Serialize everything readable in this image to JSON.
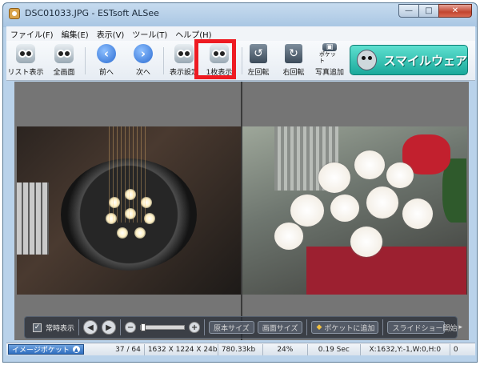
{
  "window": {
    "title": "DSC01033.JPG - ESTsoft ALSee",
    "minimize_label": "—",
    "maximize_label": "□",
    "close_label": "✕"
  },
  "menu": {
    "items": [
      "ファイル(F)",
      "編集(E)",
      "表示(V)",
      "ツール(T)",
      "ヘルプ(H)"
    ]
  },
  "toolbar": {
    "buttons": [
      {
        "label": "リスト表示",
        "icon": "list-view-icon"
      },
      {
        "label": "全画面",
        "icon": "fullscreen-icon"
      },
      {
        "label": "前へ",
        "icon": "previous-arrow-icon"
      },
      {
        "label": "次へ",
        "icon": "next-arrow-icon"
      },
      {
        "label": "表示設定",
        "icon": "display-settings-icon"
      },
      {
        "label": "1枚表示",
        "icon": "single-view-icon"
      },
      {
        "label": "左回転",
        "icon": "rotate-left-icon"
      },
      {
        "label": "右回転",
        "icon": "rotate-right-icon"
      },
      {
        "label": "写真追加",
        "icon": "add-photo-icon",
        "badge": "ポケット"
      }
    ],
    "banner_text": "スマイルウェア",
    "highlight_color": "#ee1b22"
  },
  "controls": {
    "always_show_label": "常時表示",
    "always_show_checked": true,
    "prev_symbol": "◀",
    "next_symbol": "▶",
    "zoom_out_symbol": "−",
    "zoom_in_symbol": "+",
    "original_size_label": "原本サイズ",
    "screen_size_label": "画面サイズ",
    "add_to_pocket_label": "ポケットに追加",
    "slideshow_label": "スライドショー開始"
  },
  "status": {
    "pocket_label": "イメージポケット",
    "position": "37 / 64",
    "dimensions": "1632 X 1224 X 24b",
    "file_size": "780.33kb",
    "zoom": "24%",
    "load_time": "0.19 Sec",
    "cursor_info": "X:1632,Y:-1,W:0,H:0",
    "extra": "0"
  }
}
